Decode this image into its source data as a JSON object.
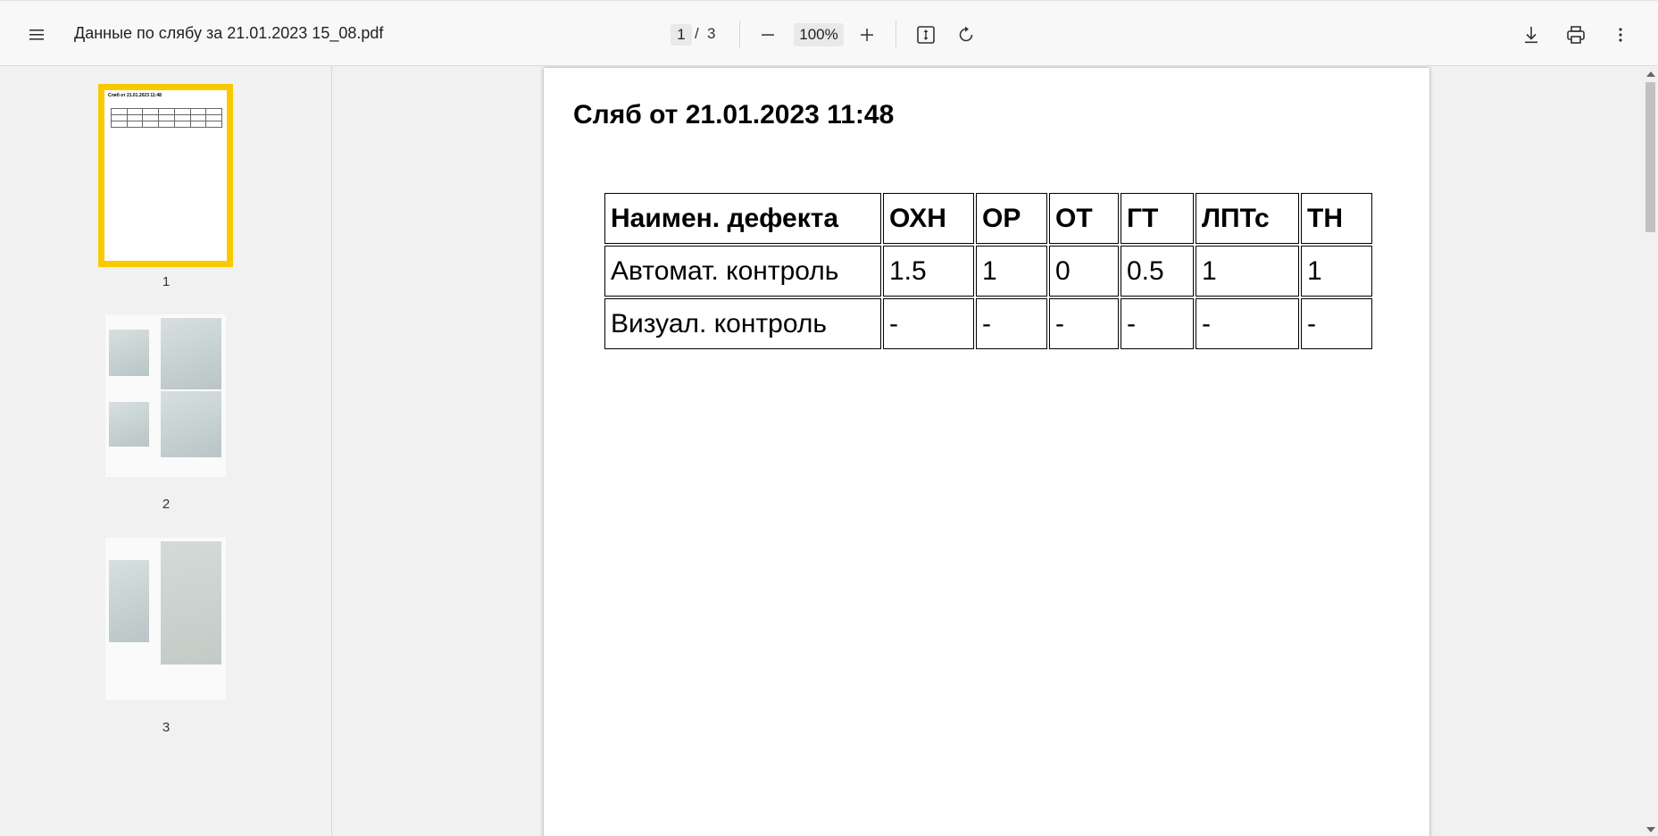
{
  "toolbar": {
    "file_name": "Данные по слябу за 21.01.2023 15_08.pdf",
    "current_page": "1",
    "page_separator": "/",
    "total_pages": "3",
    "zoom": "100%",
    "icons": [
      "menu-icon",
      "zoom-out-icon",
      "zoom-in-icon",
      "fit-page-icon",
      "rotate-icon",
      "download-icon",
      "print-icon",
      "more-vert-icon"
    ]
  },
  "sidebar": {
    "thumbnails": [
      {
        "label": "1",
        "selected": true
      },
      {
        "label": "2",
        "selected": false
      },
      {
        "label": "3",
        "selected": false
      }
    ],
    "selected_color": "#f9c900"
  },
  "document": {
    "heading": "Сляб от 21.01.2023 11:48",
    "table": {
      "headers": [
        "Наимен. дефекта",
        "ОХН",
        "ОР",
        "ОТ",
        "ГТ",
        "ЛПТс",
        "ТН"
      ],
      "rows": [
        [
          "Автомат. контроль",
          "1.5",
          "1",
          "0",
          "0.5",
          "1",
          "1"
        ],
        [
          "Визуал. контроль",
          "-",
          "-",
          "-",
          "-",
          "-",
          "-"
        ]
      ]
    }
  }
}
